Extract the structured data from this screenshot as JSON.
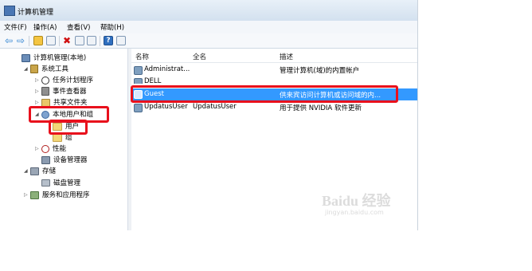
{
  "window": {
    "title": "计算机管理"
  },
  "menu": [
    "文件(F)",
    "操作(A)",
    "查看(V)",
    "帮助(H)"
  ],
  "tree": [
    {
      "label": "计算机管理(本地)",
      "icon": "computer-icon",
      "toggle": ""
    },
    {
      "label": "系统工具",
      "icon": "tools-icon",
      "toggle": "◢"
    },
    {
      "label": "任务计划程序",
      "icon": "clock-icon",
      "toggle": "▷"
    },
    {
      "label": "事件查看器",
      "icon": "event-log-icon",
      "toggle": "▷"
    },
    {
      "label": "共享文件夹",
      "icon": "shared-folder-icon",
      "toggle": "▷"
    },
    {
      "label": "本地用户和组",
      "icon": "users-icon",
      "toggle": "◢"
    },
    {
      "label": "用户",
      "icon": "folder-icon",
      "toggle": ""
    },
    {
      "label": "组",
      "icon": "folder-icon",
      "toggle": ""
    },
    {
      "label": "性能",
      "icon": "performance-icon",
      "toggle": "▷"
    },
    {
      "label": "设备管理器",
      "icon": "device-manager-icon",
      "toggle": ""
    },
    {
      "label": "存储",
      "icon": "storage-icon",
      "toggle": "◢"
    },
    {
      "label": "磁盘管理",
      "icon": "disk-icon",
      "toggle": ""
    },
    {
      "label": "服务和应用程序",
      "icon": "services-icon",
      "toggle": "▷"
    }
  ],
  "columns": {
    "name": "名称",
    "fullname": "全名",
    "description": "描述"
  },
  "users": [
    {
      "name": "Administrat...",
      "fullname": "",
      "description": "管理计算机(域)的内置帐户"
    },
    {
      "name": "DELL",
      "fullname": "",
      "description": ""
    },
    {
      "name": "Guest",
      "fullname": "",
      "description": "供来宾访问计算机或访问域的内..."
    },
    {
      "name": "UpdatusUser",
      "fullname": "UpdatusUser",
      "description": "用于提供 NVIDIA 软件更新"
    }
  ],
  "watermark": {
    "main": "Baidu 经验",
    "sub": "jingyan.baidu.com"
  },
  "colors": {
    "selection": "#3399ff",
    "highlight_box": "#e8101c"
  }
}
